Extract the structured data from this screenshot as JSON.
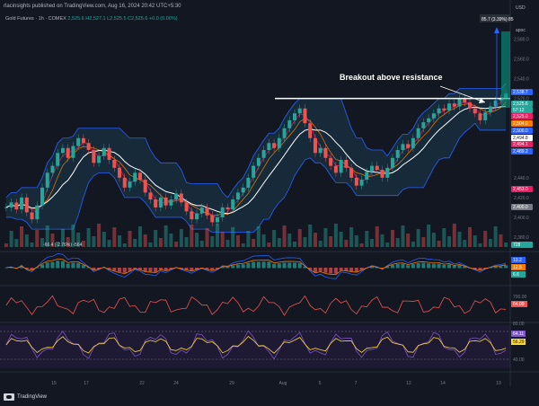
{
  "header": {
    "publisher": "rlacinsights published on TradingView.com, Aug 16, 2024 20:42 UTC+5:30"
  },
  "legend": {
    "symbol": "Gold Futures · 1h · COMEX",
    "values": "2,525.6  H2,527.1  L2,525.5  C2,525.6  +0.0 (0.00%)"
  },
  "axis": {
    "currency": "USD",
    "mode": "apoc"
  },
  "annotation": {
    "text": "Breakout above resistance"
  },
  "measure": {
    "label": "85.7 (3.39%) 85"
  },
  "footer": {
    "brand": "TradingView"
  },
  "chart_data": [
    {
      "type": "candlestick",
      "title": "Gold Futures, 1h",
      "y_ticks": [
        2380,
        2400,
        2420,
        2440,
        2480,
        2500,
        2520,
        2540,
        2560,
        2580
      ],
      "y_tick_labels": [
        "2,380.0",
        "2,400.0",
        "2,420.0",
        "2,440.0",
        "2,480.0",
        "2,500.0",
        "2,520.0",
        "2,540.0",
        "2,560.0",
        "2,580.0"
      ],
      "ylim": [
        2370,
        2605
      ],
      "x_ticks": [
        "15",
        "17",
        "22",
        "24",
        "29",
        "Aug",
        "5",
        "7",
        "12",
        "14",
        "19"
      ],
      "price_labels": [
        {
          "value": "2,538.7",
          "color": "#2962ff"
        },
        {
          "value": "2,525.6",
          "color": "#26a69a"
        },
        {
          "value": "57:12",
          "color": "#26a69a"
        },
        {
          "value": "2,525.0",
          "color": "#e91e63"
        },
        {
          "value": "2,504.0",
          "color": "#f57c00"
        },
        {
          "value": "2,500.0",
          "color": "#2962ff"
        },
        {
          "value": "2,494.8",
          "color": "#ffffff"
        },
        {
          "value": "2,494.1",
          "color": "#e91e63"
        },
        {
          "value": "2,489.2",
          "color": "#2962ff"
        },
        {
          "value": "2,453.0",
          "color": "#e91e63"
        },
        {
          "value": "2,400.0",
          "color": "#787b86"
        },
        {
          "value": "728",
          "color": "#26a69a"
        }
      ],
      "series_close": [
        2410,
        2415,
        2408,
        2420,
        2405,
        2398,
        2412,
        2430,
        2445,
        2452,
        2465,
        2470,
        2460,
        2472,
        2480,
        2475,
        2468,
        2455,
        2462,
        2470,
        2458,
        2450,
        2440,
        2430,
        2436,
        2445,
        2438,
        2425,
        2418,
        2410,
        2420,
        2412,
        2418,
        2424,
        2415,
        2406,
        2398,
        2404,
        2410,
        2402,
        2395,
        2400,
        2410,
        2408,
        2418,
        2425,
        2430,
        2440,
        2452,
        2460,
        2468,
        2475,
        2470,
        2480,
        2490,
        2498,
        2505,
        2510,
        2495,
        2480,
        2465,
        2470,
        2460,
        2452,
        2445,
        2458,
        2450,
        2440,
        2432,
        2438,
        2446,
        2452,
        2448,
        2440,
        2450,
        2460,
        2468,
        2474,
        2470,
        2480,
        2490,
        2496,
        2500,
        2505,
        2510,
        2508,
        2515,
        2512,
        2520,
        2516,
        2510,
        2505,
        2498,
        2506,
        2512,
        2518,
        2520,
        2525
      ],
      "resistance": 2520,
      "volume_note": "-66.4 (-2.76%) -564"
    },
    {
      "type": "line",
      "name": "MACD",
      "labels": [
        "13.2",
        "12.5",
        "6.6"
      ],
      "ylim": [
        -15,
        15
      ]
    },
    {
      "type": "line",
      "name": "Momentum",
      "labels": [
        "700.00",
        "64.09"
      ]
    },
    {
      "type": "line",
      "name": "RSI",
      "labels": [
        "80.00",
        "64.11",
        "56.29",
        "40.00"
      ],
      "ylim": [
        30,
        90
      ]
    }
  ]
}
